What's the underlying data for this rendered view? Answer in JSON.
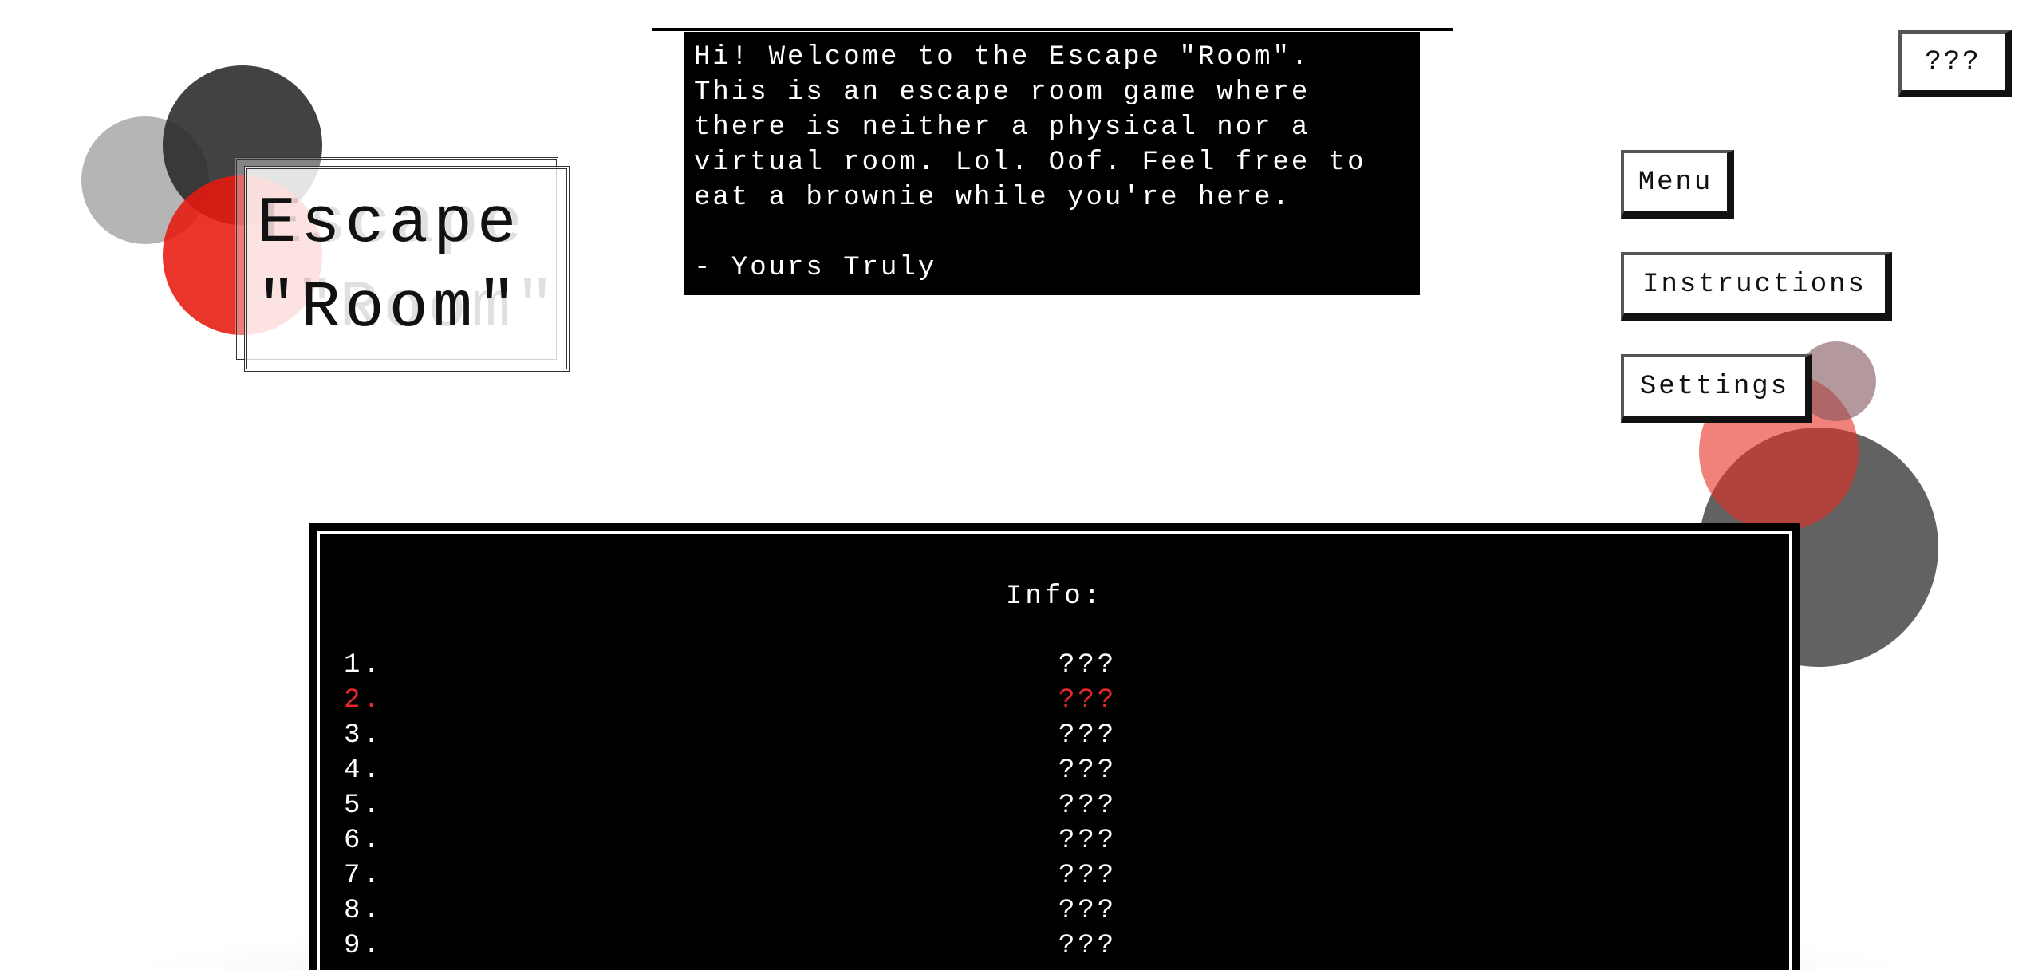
{
  "title": {
    "line1": "Escape",
    "line2": "\"Room\"",
    "ghost_line1": "Escape",
    "ghost_line2": "\"Room\""
  },
  "welcome": {
    "text": "Hi! Welcome to the Escape \"Room\".\nThis is an escape room game where\nthere is neither a physical nor a\nvirtual room. Lol. Oof. Feel free to\neat a brownie while you're here.\n\n- Yours Truly"
  },
  "buttons": {
    "mystery_label": "???",
    "menu_label": "Menu",
    "instructions_label": "Instructions",
    "settings_label": "Settings"
  },
  "info": {
    "title": "Info:",
    "rows": [
      {
        "num": "1.",
        "value": "???",
        "highlight": false
      },
      {
        "num": "2.",
        "value": "???",
        "highlight": true
      },
      {
        "num": "3.",
        "value": "???",
        "highlight": false
      },
      {
        "num": "4.",
        "value": "???",
        "highlight": false
      },
      {
        "num": "5.",
        "value": "???",
        "highlight": false
      },
      {
        "num": "6.",
        "value": "???",
        "highlight": false
      },
      {
        "num": "7.",
        "value": "???",
        "highlight": false
      },
      {
        "num": "8.",
        "value": "???",
        "highlight": false
      },
      {
        "num": "9.",
        "value": "???",
        "highlight": false
      }
    ]
  },
  "colors": {
    "accent_red": "#e8262c",
    "panel_black": "#000000",
    "text_white": "#ffffff"
  }
}
